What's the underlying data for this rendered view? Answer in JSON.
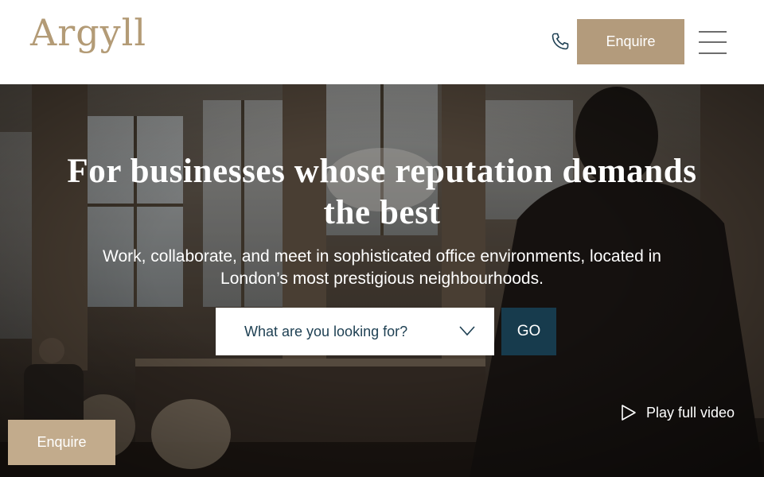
{
  "header": {
    "logo_text": "Argyll",
    "enquire_label": "Enquire"
  },
  "hero": {
    "headline": "For businesses whose reputation demands the best",
    "subline": "Work, collaborate, and meet in sophisticated office environments, located in London’s most prestigious neighbourhoods.",
    "search": {
      "placeholder": "What are you looking for?",
      "go_label": "GO"
    },
    "play_video_label": "Play full video"
  },
  "floating": {
    "enquire_label": "Enquire"
  },
  "colors": {
    "brand_gold": "#b39b7c",
    "navy": "#173b4d"
  }
}
